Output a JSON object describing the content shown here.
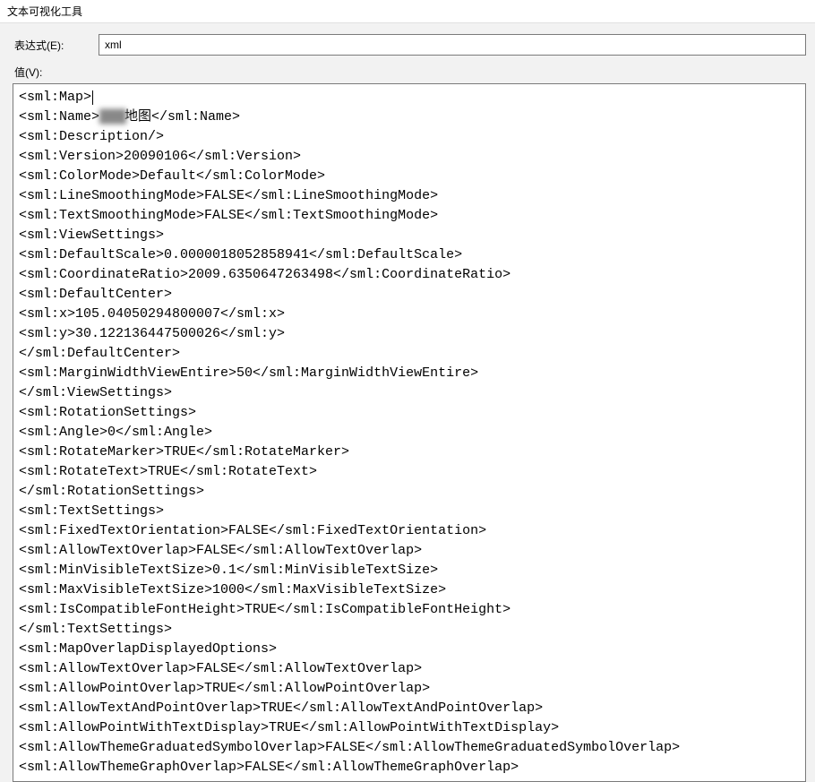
{
  "window": {
    "title": "文本可视化工具"
  },
  "form": {
    "expression_label": "表达式(E):",
    "expression_value": "xml",
    "value_label": "值(V):"
  },
  "xml_lines": [
    "<sml:Map>",
    "<sml:Name>    地图</sml:Name>",
    "<sml:Description/>",
    "<sml:Version>20090106</sml:Version>",
    "<sml:ColorMode>Default</sml:ColorMode>",
    "<sml:LineSmoothingMode>FALSE</sml:LineSmoothingMode>",
    "<sml:TextSmoothingMode>FALSE</sml:TextSmoothingMode>",
    "<sml:ViewSettings>",
    "<sml:DefaultScale>0.0000018052858941</sml:DefaultScale>",
    "<sml:CoordinateRatio>2009.6350647263498</sml:CoordinateRatio>",
    "<sml:DefaultCenter>",
    "<sml:x>105.04050294800007</sml:x>",
    "<sml:y>30.122136447500026</sml:y>",
    "</sml:DefaultCenter>",
    "<sml:MarginWidthViewEntire>50</sml:MarginWidthViewEntire>",
    "</sml:ViewSettings>",
    "<sml:RotationSettings>",
    "<sml:Angle>0</sml:Angle>",
    "<sml:RotateMarker>TRUE</sml:RotateMarker>",
    "<sml:RotateText>TRUE</sml:RotateText>",
    "</sml:RotationSettings>",
    "<sml:TextSettings>",
    "<sml:FixedTextOrientation>FALSE</sml:FixedTextOrientation>",
    "<sml:AllowTextOverlap>FALSE</sml:AllowTextOverlap>",
    "<sml:MinVisibleTextSize>0.1</sml:MinVisibleTextSize>",
    "<sml:MaxVisibleTextSize>1000</sml:MaxVisibleTextSize>",
    "<sml:IsCompatibleFontHeight>TRUE</sml:IsCompatibleFontHeight>",
    "</sml:TextSettings>",
    "<sml:MapOverlapDisplayedOptions>",
    "<sml:AllowTextOverlap>FALSE</sml:AllowTextOverlap>",
    "<sml:AllowPointOverlap>TRUE</sml:AllowPointOverlap>",
    "<sml:AllowTextAndPointOverlap>TRUE</sml:AllowTextAndPointOverlap>",
    "<sml:AllowPointWithTextDisplay>TRUE</sml:AllowPointWithTextDisplay>",
    "<sml:AllowThemeGraduatedSymbolOverlap>FALSE</sml:AllowThemeGraduatedSymbolOverlap>",
    "<sml:AllowThemeGraphOverlap>FALSE</sml:AllowThemeGraphOverlap>"
  ]
}
